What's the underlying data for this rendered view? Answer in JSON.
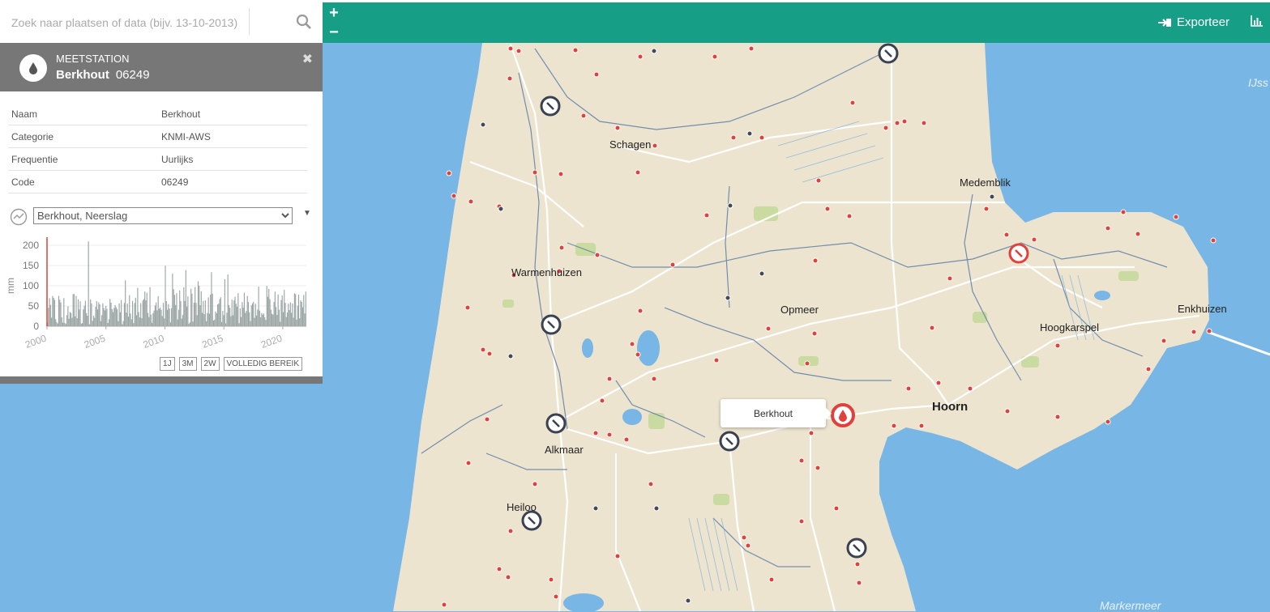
{
  "search": {
    "placeholder": "Zoek naar plaatsen of data (bijv. 13-10-2013)"
  },
  "toolbar": {
    "zoom_in": "+",
    "zoom_out": "−",
    "export_label": "Exporteer"
  },
  "station": {
    "type": "MEETSTATION",
    "name": "Berkhout",
    "code": "06249",
    "close": "✖",
    "details": [
      {
        "label": "Naam",
        "value": "Berkhout"
      },
      {
        "label": "Categorie",
        "value": "KNMI-AWS"
      },
      {
        "label": "Frequentie",
        "value": "Uurlijks"
      },
      {
        "label": "Code",
        "value": "06249"
      }
    ],
    "selected_series": "Berkhout, Neerslag",
    "range_buttons": [
      "1J",
      "3M",
      "2W",
      "VOLLEDIG BEREIK"
    ]
  },
  "chart_data": {
    "type": "bar",
    "ylabel": "mm",
    "ylim": [
      0,
      220
    ],
    "yticks": [
      "0",
      "50",
      "100",
      "150",
      "200"
    ],
    "xticks": [
      "2000",
      "2005",
      "2010",
      "2015",
      "2020"
    ],
    "x_range": [
      2000,
      2022
    ],
    "values": [
      9.3,
      45.5,
      69.3,
      52.7,
      21.3,
      74.8,
      70.1,
      65.2,
      17.3,
      10.6,
      6.8,
      75.0,
      65.5,
      58.9,
      22.1,
      8.9,
      69.7,
      8.2,
      5.5,
      27.5,
      49.4,
      18.7,
      34.9,
      32.9,
      20.9,
      79.3,
      79.6,
      24.4,
      75.2,
      19.5,
      66.6,
      41.2,
      61.6,
      6.5,
      7.6,
      41.6,
      50.8,
      63.1,
      32.5,
      26.0,
      209.6,
      4.8,
      66.1,
      56.6,
      13.3,
      26.2,
      20.9,
      47.8,
      62.1,
      41.5,
      59.0,
      54.0,
      12.8,
      27.3,
      56.7,
      45.1,
      39.0,
      50.3,
      42.7,
      7.9,
      17.3,
      67.6,
      58.1,
      42.7,
      34.7,
      45.2,
      52.2,
      47.2,
      42.5,
      12.5,
      56.5,
      34.4,
      64.9,
      5.0,
      13.1,
      57.5,
      113.6,
      33.7,
      56.0,
      23.8,
      76.8,
      31.4,
      17.3,
      62.6,
      7.8,
      57.5,
      70.4,
      27.3,
      94.7,
      35.1,
      21.7,
      57.2,
      19.8,
      63.6,
      67.3,
      85.8,
      64.0,
      82.8,
      32.9,
      22.4,
      96.6,
      28.9,
      8.2,
      32.5,
      38.6,
      51.2,
      58.9,
      39.2,
      74.3,
      43.1,
      46.3,
      40.8,
      25.3,
      57.9,
      19.1,
      149.5,
      62.1,
      40.6,
      54.7,
      43.6,
      9.5,
      44.8,
      129.9,
      91.5,
      77.5,
      52.4,
      81.7,
      16.8,
      40.7,
      88.5,
      62.2,
      18.6,
      28.1,
      96.4,
      62.5,
      138.9,
      48.4,
      73.8,
      6.2,
      9.7,
      92.8,
      80.7,
      11.4,
      57.9,
      96.9,
      57.8,
      27.2,
      111.1,
      100.3,
      51.9,
      86.4,
      33.2,
      62.6,
      30.0,
      63.7,
      12.3,
      32.5,
      71.2,
      31.0,
      78.3,
      133.7,
      80.3,
      14.2,
      16.2,
      36.6,
      32.2,
      53.9,
      55.9,
      67.2,
      71.6,
      10.3,
      38.0,
      27.2,
      116.3,
      7.1,
      33.5,
      127.8,
      52.3,
      45.4,
      24.9,
      65.8,
      27.2,
      63.8,
      72.8,
      55.6,
      48.2,
      81.8,
      7.5,
      44.2,
      22.7,
      59.7,
      46.4,
      82.9,
      32.9,
      37.8,
      74.8,
      60.0,
      34.6,
      13.1,
      51.7,
      56.6,
      60.6,
      20.8,
      55.4,
      26.4,
      41.2,
      97.9,
      38.6,
      21.9,
      32.7,
      28.4,
      31.6,
      22.2,
      15.6,
      99.8,
      72.8,
      92.3,
      67.0,
      41.1,
      30.9,
      28.8,
      59.9,
      85.5,
      47.5,
      28.0,
      78.3,
      40.8,
      11.1,
      64.8,
      76.1,
      34.8,
      89.7,
      58.0,
      22.7,
      34.0,
      56.0,
      39.8,
      59.2,
      33.3,
      56.3,
      21.2,
      81.1,
      79.6,
      16.3,
      50.6,
      78.1,
      19.5,
      63.8,
      60.2,
      46.9,
      77.1,
      31.5,
      85.7
    ]
  },
  "map": {
    "tooltip": "Berkhout",
    "places": [
      {
        "name": "Schagen",
        "big": false
      },
      {
        "name": "Medemblik",
        "big": false
      },
      {
        "name": "Warmenhuizen",
        "big": false
      },
      {
        "name": "Opmeer",
        "big": false
      },
      {
        "name": "Enkhuizen",
        "big": false
      },
      {
        "name": "Hoogkarspel",
        "big": false
      },
      {
        "name": "Hoorn",
        "big": true
      },
      {
        "name": "Alkmaar",
        "big": false
      },
      {
        "name": "Heiloo",
        "big": false
      }
    ],
    "water_labels": [
      "IJss",
      "Markermeer"
    ]
  }
}
